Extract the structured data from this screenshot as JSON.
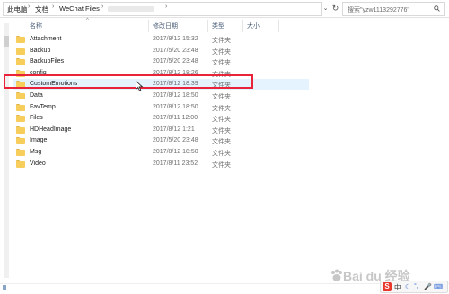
{
  "address_bar": {
    "breadcrumbs": [
      "此电脑",
      "文档",
      "WeChat Files"
    ],
    "search_placeholder": "搜索\"yzw1113292776\""
  },
  "columns": {
    "name": "名称",
    "date": "修改日期",
    "type": "类型",
    "size": "大小"
  },
  "files": [
    {
      "name": "Attachment",
      "date": "2017/8/12 15:32",
      "type": "文件夹"
    },
    {
      "name": "Backup",
      "date": "2017/5/20 23:48",
      "type": "文件夹"
    },
    {
      "name": "BackupFiles",
      "date": "2017/5/20 23:48",
      "type": "文件夹"
    },
    {
      "name": "config",
      "date": "2017/8/12 18:26",
      "type": "文件夹"
    },
    {
      "name": "CustomEmotions",
      "date": "2017/8/12 18:39",
      "type": "文件夹"
    },
    {
      "name": "Data",
      "date": "2017/8/12 18:50",
      "type": "文件夹"
    },
    {
      "name": "FavTemp",
      "date": "2017/8/12 18:50",
      "type": "文件夹"
    },
    {
      "name": "Files",
      "date": "2017/8/11 12:00",
      "type": "文件夹"
    },
    {
      "name": "HDHeadImage",
      "date": "2017/8/12 1:21",
      "type": "文件夹"
    },
    {
      "name": "Image",
      "date": "2017/5/20 23:48",
      "type": "文件夹"
    },
    {
      "name": "Msg",
      "date": "2017/8/12 18:50",
      "type": "文件夹"
    },
    {
      "name": "Video",
      "date": "2017/8/11 23:52",
      "type": "文件夹"
    }
  ],
  "selected_index": 4,
  "colors": {
    "highlight_border": "#e8233a",
    "selection_bg": "#e5f3ff",
    "folder": "#f7ce5b"
  },
  "watermark": {
    "text": "Bai du 经验"
  },
  "ime": {
    "label": "中"
  }
}
